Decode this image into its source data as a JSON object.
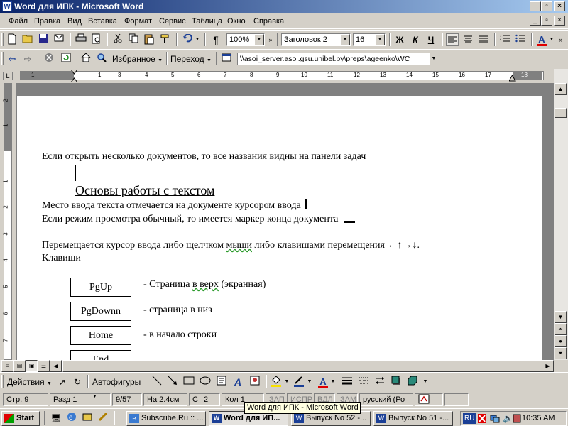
{
  "window": {
    "title": "Word для  ИПК - Microsoft Word",
    "app_icon": "W",
    "min": "_",
    "max": "▫",
    "close": "×"
  },
  "menu": [
    "Файл",
    "Правка",
    "Вид",
    "Вставка",
    "Формат",
    "Сервис",
    "Таблица",
    "Окно",
    "Справка"
  ],
  "mdi": {
    "min": "_",
    "restore": "▫",
    "close": "×"
  },
  "standard_toolbar": {
    "zoom": "100%",
    "style": "Заголовок 2",
    "size": "16",
    "bold": "Ж",
    "italic": "К",
    "underline": "Ч",
    "pilcrow": "¶"
  },
  "web_toolbar": {
    "favorites": "Избранное",
    "goto": "Переход",
    "address": "\\\\asoi_server.asoi.gsu.unibel.by\\preps\\ageenko\\WC"
  },
  "ruler_numbers": [
    "1",
    "1",
    "2",
    "3",
    "4",
    "5",
    "6",
    "7",
    "8",
    "9",
    "10",
    "11",
    "12",
    "13",
    "14",
    "15",
    "16",
    "17",
    "18"
  ],
  "vruler_numbers": [
    "2",
    "1",
    "1",
    "2",
    "3",
    "4",
    "5",
    "6",
    "7"
  ],
  "document": {
    "line1_a": "Если открыть несколько документов, то все названия видны на ",
    "line1_link": "панели задач",
    "heading": "Основы работы с текстом",
    "line3": "Место ввода текста отмечается на документе курсором ввода",
    "line4": "Если режим просмотра обычный, то имеется маркер конца документа",
    "line5_a": "Перемещается курсор ввода либо щелчком ",
    "line5_b": "мыши",
    "line5_c": " либо клавишами перемещения ←↑→↓.",
    "line6": "Клавиши",
    "keys": [
      {
        "key": "PgUp",
        "desc_a": "- Страница ",
        "desc_b": "в верх",
        "desc_c": " (экранная)"
      },
      {
        "key": "PgDownn",
        "desc_a": "- страница в низ",
        "desc_b": "",
        "desc_c": ""
      },
      {
        "key": "Home",
        "desc_a": "- в начало строки",
        "desc_b": "",
        "desc_c": ""
      },
      {
        "key": "End",
        "desc_a": "",
        "desc_b": "",
        "desc_c": ""
      }
    ]
  },
  "drawing_toolbar": {
    "actions": "Действия",
    "autoshapes": "Автофигуры"
  },
  "status": {
    "page": "Стр.  9",
    "section": "Разд  1",
    "pages": "9/57",
    "at": "На 2.4см",
    "line": "Ст  2",
    "col": "Кол  1",
    "rec": "ЗАП",
    "trk": "ИСПР",
    "ext": "ВДЛ",
    "ovr": "ЗАМ",
    "lang": "русский (Ро"
  },
  "tooltip": "Word для  ИПК - Microsoft Word",
  "taskbar": {
    "start": "Start",
    "buttons": [
      "Subscribe.Ru :: ...",
      "Word для  ИП...",
      "Выпуск No 52 -...",
      "Выпуск No 51 -..."
    ],
    "lang": "RU",
    "clock": "10:35 AM"
  }
}
